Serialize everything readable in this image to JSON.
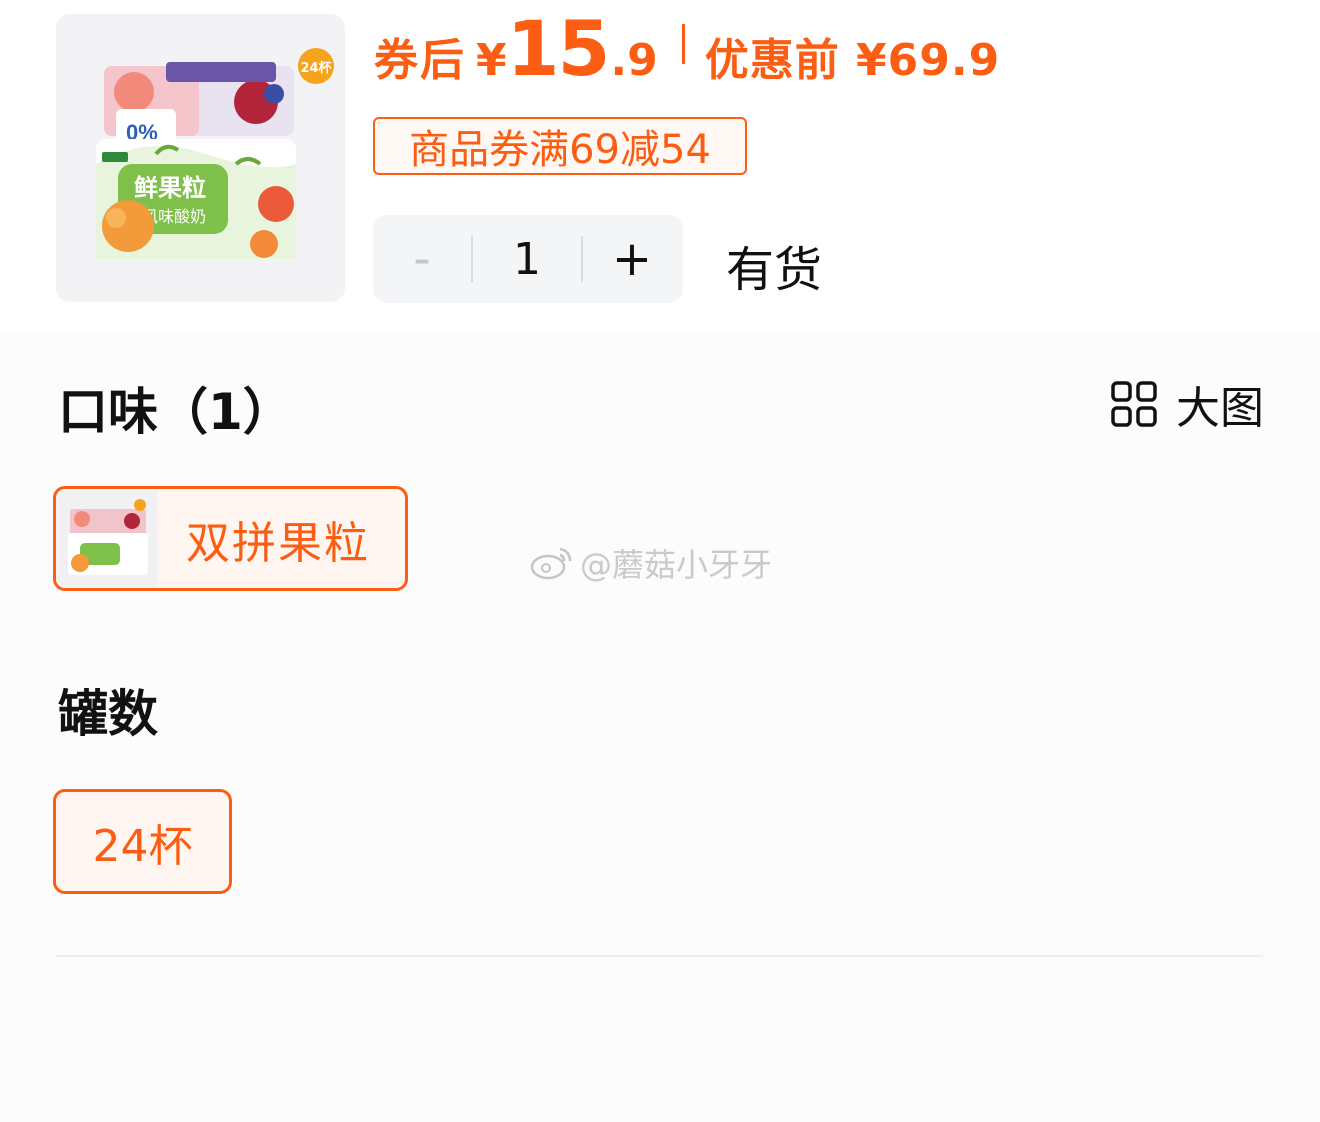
{
  "product": {
    "cup_badge": "24杯",
    "price_after_label": "券后",
    "price_currency": "¥",
    "price_after_int": "15",
    "price_after_dec": ".9",
    "price_before": "优惠前 ¥69.9",
    "coupon_tag": "商品券满69减54"
  },
  "stepper": {
    "minus": "-",
    "value": "1",
    "plus": "+"
  },
  "stock_status": "有货",
  "flavor": {
    "title": "口味（1）",
    "big_image_label": "大图",
    "options": [
      {
        "label": "双拼果粒",
        "selected": true
      }
    ]
  },
  "cans": {
    "title": "罐数",
    "options": [
      {
        "label": "24杯",
        "selected": true
      }
    ]
  },
  "watermark": "@蘑菇小牙牙",
  "colors": {
    "accent": "#fb5d12",
    "stepper_bg": "#f4f5f7"
  },
  "icons": [
    "grid-view-icon",
    "weibo-icon"
  ]
}
